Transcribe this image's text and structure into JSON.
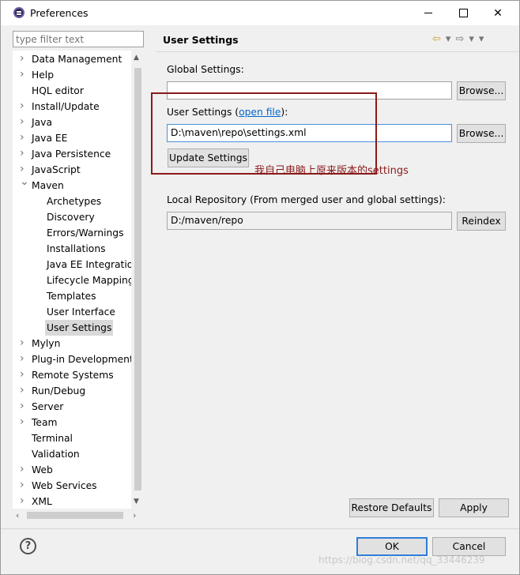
{
  "window": {
    "title": "Preferences",
    "close_glyph": "✕"
  },
  "sidebar": {
    "filter_placeholder": "type filter text",
    "items": [
      {
        "label": "Data Management",
        "expandable": true
      },
      {
        "label": "Help",
        "expandable": true
      },
      {
        "label": "HQL editor",
        "expandable": false
      },
      {
        "label": "Install/Update",
        "expandable": true
      },
      {
        "label": "Java",
        "expandable": true
      },
      {
        "label": "Java EE",
        "expandable": true
      },
      {
        "label": "Java Persistence",
        "expandable": true
      },
      {
        "label": "JavaScript",
        "expandable": true
      },
      {
        "label": "Maven",
        "expandable": true,
        "expanded": true
      },
      {
        "label": "Archetypes",
        "child": true
      },
      {
        "label": "Discovery",
        "child": true
      },
      {
        "label": "Errors/Warnings",
        "child": true
      },
      {
        "label": "Installations",
        "child": true
      },
      {
        "label": "Java EE Integration",
        "child": true
      },
      {
        "label": "Lifecycle Mapping",
        "child": true
      },
      {
        "label": "Templates",
        "child": true
      },
      {
        "label": "User Interface",
        "child": true
      },
      {
        "label": "User Settings",
        "child": true,
        "selected": true
      },
      {
        "label": "Mylyn",
        "expandable": true
      },
      {
        "label": "Plug-in Development",
        "expandable": true
      },
      {
        "label": "Remote Systems",
        "expandable": true
      },
      {
        "label": "Run/Debug",
        "expandable": true
      },
      {
        "label": "Server",
        "expandable": true
      },
      {
        "label": "Team",
        "expandable": true
      },
      {
        "label": "Terminal",
        "expandable": false
      },
      {
        "label": "Validation",
        "expandable": false
      },
      {
        "label": "Web",
        "expandable": true
      },
      {
        "label": "Web Services",
        "expandable": true
      },
      {
        "label": "XML",
        "expandable": true
      }
    ]
  },
  "main": {
    "title": "User Settings",
    "global_settings_label": "Global Settings:",
    "global_settings_value": "",
    "user_settings_label_prefix": "User Settings (",
    "user_settings_link": "open file",
    "user_settings_label_suffix": "):",
    "user_settings_value": "D:\\maven\\repo\\settings.xml",
    "browse_label": "Browse...",
    "update_settings_label": "Update Settings",
    "local_repo_label": "Local Repository (From merged user and global settings):",
    "local_repo_value": "D:/maven/repo",
    "reindex_label": "Reindex",
    "restore_defaults_label": "Restore Defaults",
    "apply_label": "Apply",
    "annotation": "我自己电脑上原来版本的settings"
  },
  "footer": {
    "help_glyph": "?",
    "ok_label": "OK",
    "cancel_label": "Cancel",
    "watermark": "https://blog.csdn.net/qq_33446239"
  },
  "colors": {
    "annotation": "#8b1a1a",
    "link": "#0066cc",
    "focus_border": "#2f7dd8"
  }
}
